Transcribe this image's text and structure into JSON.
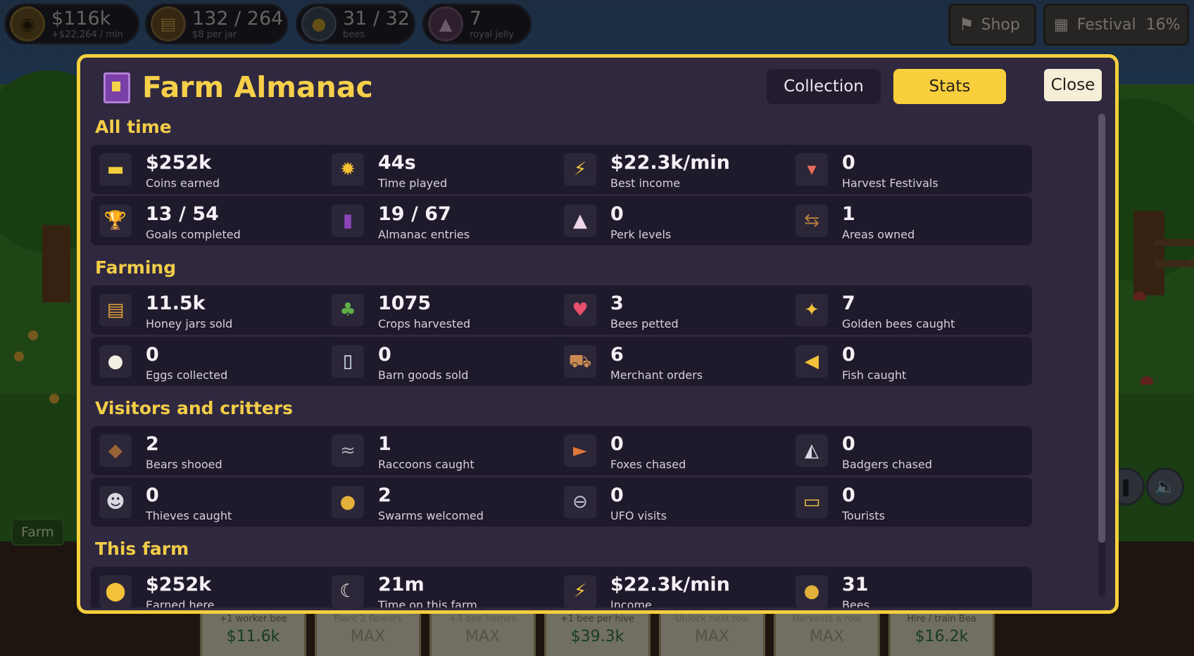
{
  "hud": {
    "coins": {
      "value": "$116k",
      "sub": "+$22,264 / min",
      "icon": "coin-icon"
    },
    "jars": {
      "value": "132 / 264",
      "sub": "$8 per jar",
      "icon": "honey-jar-icon"
    },
    "bees": {
      "value": "31 / 32",
      "sub": "bees",
      "icon": "bee-icon"
    },
    "jelly": {
      "value": "7",
      "sub": "royal jelly",
      "icon": "royal-jelly-icon"
    },
    "shop_label": "Shop",
    "festival_label": "Festival",
    "festival_percent": "16%"
  },
  "background": {
    "farm_label": "Farm",
    "upgrades": [
      {
        "label": "+1 worker bee",
        "cost": "$11.6k"
      },
      {
        "label": "Plant 2 flowers",
        "cost": "MAX"
      },
      {
        "label": "+3 bee homes",
        "cost": "MAX"
      },
      {
        "label": "+1 bee per hive",
        "cost": "$39.3k"
      },
      {
        "label": "Unlock next row",
        "cost": "MAX"
      },
      {
        "label": "Harvests a row",
        "cost": "MAX"
      },
      {
        "label": "Hire / train Bea",
        "cost": "$16.2k"
      }
    ]
  },
  "modal": {
    "title": "Farm Almanac",
    "tabs": {
      "collection": "Collection",
      "stats": "Stats"
    },
    "active_tab": "Stats",
    "close_label": "Close",
    "accent_color": "#f4cf3e",
    "sections": [
      {
        "title": "All time",
        "stats": [
          {
            "value": "$252k",
            "label": "Coins earned",
            "icon": "coins-stack-icon"
          },
          {
            "value": "44s",
            "label": "Time played",
            "icon": "sun-icon"
          },
          {
            "value": "$22.3k/min",
            "label": "Best income",
            "icon": "lightning-icon"
          },
          {
            "value": "0",
            "label": "Harvest Festivals",
            "icon": "festival-bunting-icon"
          },
          {
            "value": "13 / 54",
            "label": "Goals completed",
            "icon": "trophy-icon"
          },
          {
            "value": "19 / 67",
            "label": "Almanac entries",
            "icon": "almanac-book-icon"
          },
          {
            "value": "0",
            "label": "Perk levels",
            "icon": "royal-jelly-icon"
          },
          {
            "value": "1",
            "label": "Areas owned",
            "icon": "signpost-icon"
          }
        ]
      },
      {
        "title": "Farming",
        "stats": [
          {
            "value": "11.5k",
            "label": "Honey jars sold",
            "icon": "honey-jar-icon"
          },
          {
            "value": "1075",
            "label": "Crops harvested",
            "icon": "crop-sprout-icon"
          },
          {
            "value": "3",
            "label": "Bees petted",
            "icon": "heart-icon"
          },
          {
            "value": "7",
            "label": "Golden bees caught",
            "icon": "golden-bee-icon"
          },
          {
            "value": "0",
            "label": "Eggs collected",
            "icon": "egg-icon"
          },
          {
            "value": "0",
            "label": "Barn goods sold",
            "icon": "milk-bottle-icon"
          },
          {
            "value": "6",
            "label": "Merchant orders",
            "icon": "merchant-cart-icon"
          },
          {
            "value": "0",
            "label": "Fish caught",
            "icon": "fish-icon"
          }
        ]
      },
      {
        "title": "Visitors and critters",
        "stats": [
          {
            "value": "2",
            "label": "Bears shooed",
            "icon": "bear-icon"
          },
          {
            "value": "1",
            "label": "Raccoons caught",
            "icon": "raccoon-icon"
          },
          {
            "value": "0",
            "label": "Foxes chased",
            "icon": "fox-icon"
          },
          {
            "value": "0",
            "label": "Badgers chased",
            "icon": "badger-icon"
          },
          {
            "value": "0",
            "label": "Thieves caught",
            "icon": "thief-icon"
          },
          {
            "value": "2",
            "label": "Swarms welcomed",
            "icon": "swarm-bee-icon"
          },
          {
            "value": "0",
            "label": "UFO visits",
            "icon": "ufo-icon"
          },
          {
            "value": "0",
            "label": "Tourists",
            "icon": "tour-bus-icon"
          }
        ]
      },
      {
        "title": "This farm",
        "stats": [
          {
            "value": "$252k",
            "label": "Earned here",
            "icon": "gold-coin-icon"
          },
          {
            "value": "21m",
            "label": "Time on this farm",
            "icon": "moon-icon"
          },
          {
            "value": "$22.3k/min",
            "label": "Income",
            "icon": "lightning-icon"
          },
          {
            "value": "31",
            "label": "Bees",
            "icon": "bee-icon"
          }
        ]
      }
    ]
  }
}
